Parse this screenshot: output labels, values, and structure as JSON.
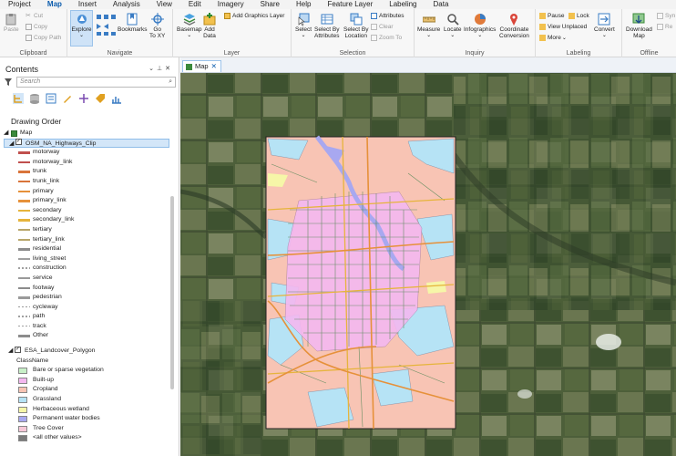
{
  "ribbon_tabs": [
    "Project",
    "Map",
    "Insert",
    "Analysis",
    "View",
    "Edit",
    "Imagery",
    "Share",
    "Help",
    "Feature Layer",
    "Labeling",
    "Data"
  ],
  "ribbon": {
    "paste": "Paste",
    "cut": "Cut",
    "copy": "Copy",
    "copy_path": "Copy Path",
    "clipboard": "Clipboard",
    "explore": "Explore",
    "bookmarks": "Bookmarks",
    "go_to_xy": "Go\nTo XY",
    "navigate": "Navigate",
    "basemap": "Basemap",
    "add_data": "Add\nData",
    "add_graphics_layer": "Add Graphics Layer",
    "layer": "Layer",
    "select": "Select",
    "select_by_attributes": "Select By\nAttributes",
    "select_by_location": "Select By\nLocation",
    "attributes": "Attributes",
    "clear": "Clear",
    "zoom_to": "Zoom To",
    "selection": "Selection",
    "measure": "Measure",
    "locate": "Locate",
    "infographics": "Infographics",
    "coordinate_conversion": "Coordinate\nConversion",
    "inquiry": "Inquiry",
    "pause": "Pause",
    "lock": "Lock",
    "view_unplaced": "View Unplaced",
    "more": "More",
    "convert": "Convert",
    "labeling": "Labeling",
    "download_map": "Download\nMap",
    "sync": "Syn",
    "remove": "Re",
    "offline": "Offline"
  },
  "contents": {
    "title": "Contents",
    "search_placeholder": "Search",
    "drawing_order": "Drawing Order",
    "map_name": "Map",
    "layer1": {
      "name": "OSM_NA_Highways_Clip",
      "classes": [
        {
          "label": "motorway",
          "color": "#c0504d",
          "style": "solid"
        },
        {
          "label": "motorway_link",
          "color": "#c0504d",
          "style": "solid"
        },
        {
          "label": "trunk",
          "color": "#d9743a",
          "style": "solid"
        },
        {
          "label": "trunk_link",
          "color": "#d9743a",
          "style": "solid"
        },
        {
          "label": "primary",
          "color": "#e6913a",
          "style": "solid"
        },
        {
          "label": "primary_link",
          "color": "#e6913a",
          "style": "solid"
        },
        {
          "label": "secondary",
          "color": "#e6b43c",
          "style": "solid"
        },
        {
          "label": "secondary_link",
          "color": "#e6b43c",
          "style": "solid"
        },
        {
          "label": "tertiary",
          "color": "#b8a66a",
          "style": "solid"
        },
        {
          "label": "tertiary_link",
          "color": "#b8a66a",
          "style": "solid"
        },
        {
          "label": "residential",
          "color": "#8c8c8c",
          "style": "solid"
        },
        {
          "label": "living_street",
          "color": "#a0a0a0",
          "style": "solid"
        },
        {
          "label": "construction",
          "color": "#a0a0a0",
          "style": "dash"
        },
        {
          "label": "service",
          "color": "#9a9a9a",
          "style": "solid"
        },
        {
          "label": "footway",
          "color": "#8c8c8c",
          "style": "solid"
        },
        {
          "label": "pedestrian",
          "color": "#9a9a9a",
          "style": "solid"
        },
        {
          "label": "cycleway",
          "color": "#9a9a9a",
          "style": "dash"
        },
        {
          "label": "path",
          "color": "#a0a0a0",
          "style": "dash"
        },
        {
          "label": "track",
          "color": "#a0a0a0",
          "style": "dash"
        },
        {
          "label": "Other",
          "color": "#8c8c8c",
          "style": "solid"
        }
      ]
    },
    "layer2": {
      "name": "ESA_Landcover_Polygon",
      "field": "ClassName",
      "classes": [
        {
          "label": "Bare or sparse vegetation",
          "color": "#c8f0c8"
        },
        {
          "label": "Built-up",
          "color": "#f4b8f0"
        },
        {
          "label": "Cropland",
          "color": "#f8c4b4"
        },
        {
          "label": "Grassland",
          "color": "#b6e3f5"
        },
        {
          "label": "Herbaceous wetland",
          "color": "#f6f6a8"
        },
        {
          "label": "Permanent water bodies",
          "color": "#a8a8f0"
        },
        {
          "label": "Tree Cover",
          "color": "#f6c8d8"
        },
        {
          "label": "<all other values>",
          "color": "#7a7a7a"
        }
      ]
    }
  },
  "map_tab": {
    "label": "Map"
  },
  "colors": {
    "accent": "#0b5cad",
    "cropland": "#f8c4b4",
    "grassland": "#b6e3f5",
    "builtup": "#f4b8f0",
    "water": "#a8a8f0",
    "road_primary": "#e6913a",
    "road_secondary": "#e6b43c",
    "road_minor": "#5a8a5a"
  }
}
